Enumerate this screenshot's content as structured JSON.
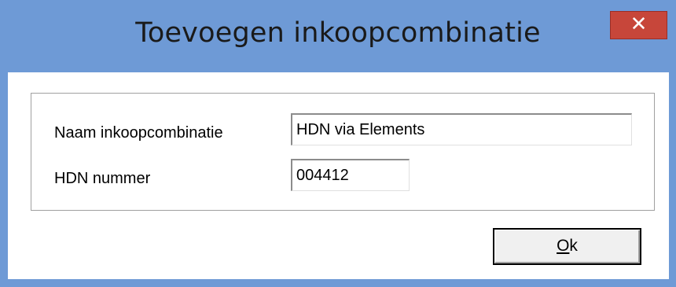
{
  "window": {
    "title": "Toevoegen inkoopcombinatie",
    "close_glyph": "✕",
    "close_icon": "close-icon",
    "titlebar_color": "#6e9ad6",
    "close_color": "#c7463a"
  },
  "form": {
    "naam_label": "Naam inkoopcombinatie",
    "naam_value": "HDN via Elements",
    "hdn_label": "HDN nummer",
    "hdn_value": "004412"
  },
  "buttons": {
    "ok_mnemonic": "O",
    "ok_rest": "k"
  }
}
